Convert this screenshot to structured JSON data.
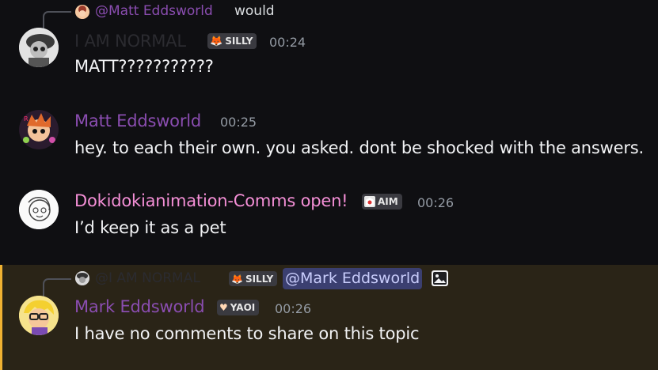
{
  "messages": [
    {
      "reply": {
        "author": "@Matt Eddsworld",
        "text": "would"
      },
      "author": "I AM NORMAL",
      "badge": "SILLY",
      "time": "00:24",
      "text": "MATT???????????"
    },
    {
      "author": "Matt Eddsworld",
      "time": "00:25",
      "text": "hey. to each their own. you asked. dont be shocked with the answers."
    },
    {
      "author": "Dokidokianimation-Comms open!",
      "badge": "AIM",
      "time": "00:26",
      "text": "I’d keep it as a pet"
    },
    {
      "reply": {
        "author": "@I AM NORMAL",
        "badge": "SILLY",
        "mention": "@Mark Eddsworld"
      },
      "author": "Mark Eddsworld",
      "badge": "YAOI",
      "time": "00:26",
      "text": "I have no comments to share on this topic"
    }
  ],
  "colors": {
    "matt": "#8a4db0",
    "doki": "#f48fd6",
    "normal": "#2b2b30",
    "mention_bg": "#3b3f70",
    "highlight_bg": "#2a2417",
    "highlight_bar": "#f0b232"
  },
  "icons": {
    "silly": "fox-icon",
    "aim": "aim-emblem-icon",
    "yaoi": "heart-icon",
    "attachment": "image-icon"
  }
}
